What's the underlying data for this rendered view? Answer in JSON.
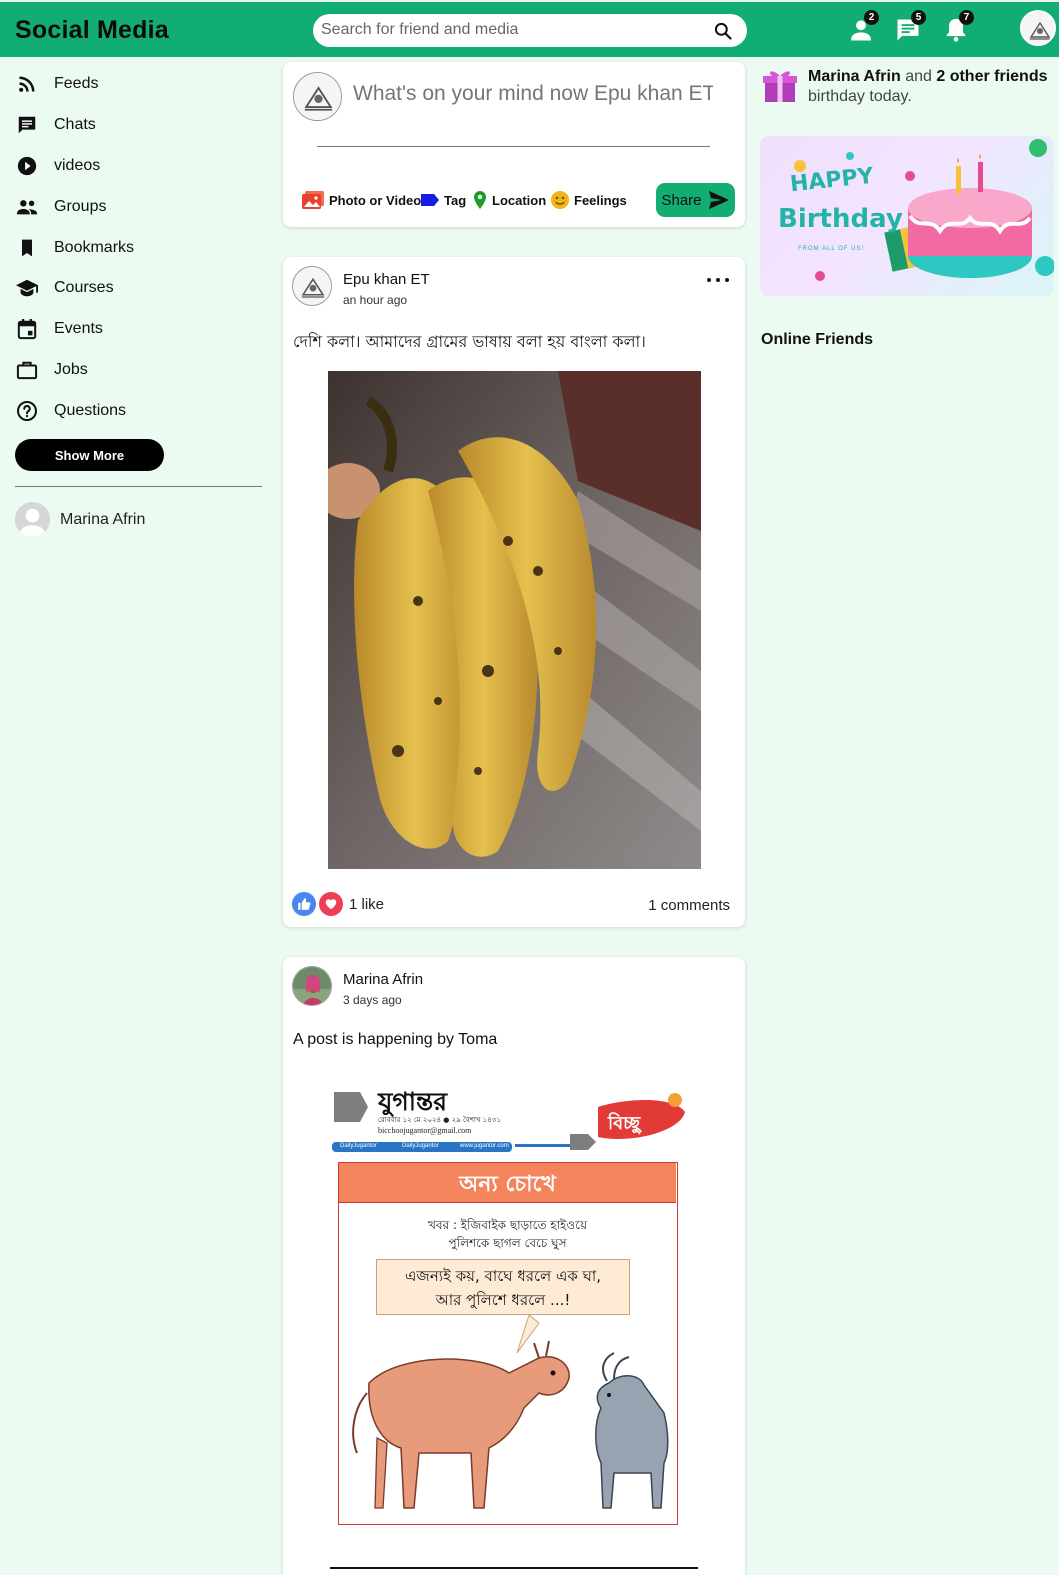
{
  "header": {
    "brand": "Social Media",
    "search_placeholder": "Search for friend and media",
    "badges": {
      "friend_requests": "2",
      "messages": "5",
      "notifications": "7"
    }
  },
  "sidebar": {
    "items": [
      {
        "label": "Feeds",
        "icon": "rss-icon"
      },
      {
        "label": "Chats",
        "icon": "chat-icon"
      },
      {
        "label": "videos",
        "icon": "play-circle-icon"
      },
      {
        "label": "Groups",
        "icon": "group-icon"
      },
      {
        "label": "Bookmarks",
        "icon": "bookmark-icon"
      },
      {
        "label": "Courses",
        "icon": "school-icon"
      },
      {
        "label": "Events",
        "icon": "calendar-icon"
      },
      {
        "label": "Jobs",
        "icon": "briefcase-icon"
      },
      {
        "label": "Questions",
        "icon": "help-circle-icon"
      }
    ],
    "show_more": "Show More",
    "friends": [
      {
        "name": "Marina Afrin"
      }
    ]
  },
  "composer": {
    "placeholder": "What's on your mind now Epu khan ET",
    "options": {
      "photo": "Photo or Video",
      "tag": "Tag",
      "location": "Location",
      "feelings": "Feelings"
    },
    "share": "Share"
  },
  "posts": [
    {
      "author": "Epu khan ET",
      "time": "an hour ago",
      "text": "দেশি কলা। আমাদের গ্রামের ভাষায় বলা হয় বাংলা কলা।",
      "likes": "1 like",
      "comments": "1 comments"
    },
    {
      "author": "Marina Afrin",
      "time": "3 days ago",
      "text": "A post is happening by Toma",
      "cartoon": {
        "masthead": "যুগান্তর",
        "date_line": "রোববার ১২ মে ২০২৪ ● ২৯ বৈশাখ ১৪৩১",
        "email": "bicchoojugantor@gmail.com",
        "socials": [
          "DailyJugantor",
          "DailyJugantor",
          "www.jugantor.com"
        ],
        "section": "বিচ্ছু",
        "heading": "অন্য চোখে",
        "news_line1": "খবর : ইজিবাইক ছাড়াতে হাইওয়ে",
        "news_line2": "পুলিশকে ছাগল বেচে ঘুস",
        "bubble_line1": "এজন্যই কয়, বাঘে ধরলে এক ঘা,",
        "bubble_line2": "আর পুলিশে ধরলে ...!"
      }
    }
  ],
  "right": {
    "birthday_name": "Marina Afrin",
    "birthday_and": "and",
    "birthday_others": "2 other friends",
    "birthday_suffix": "birthday today.",
    "banner_line1": "HAPPY",
    "banner_line2": "Birthday",
    "banner_sub": "FROM ALL OF US!",
    "online_title": "Online Friends"
  },
  "colors": {
    "primary": "#11ad73",
    "background": "#ecfbf2",
    "like": "#4a86f0",
    "love": "#ee3e55"
  }
}
